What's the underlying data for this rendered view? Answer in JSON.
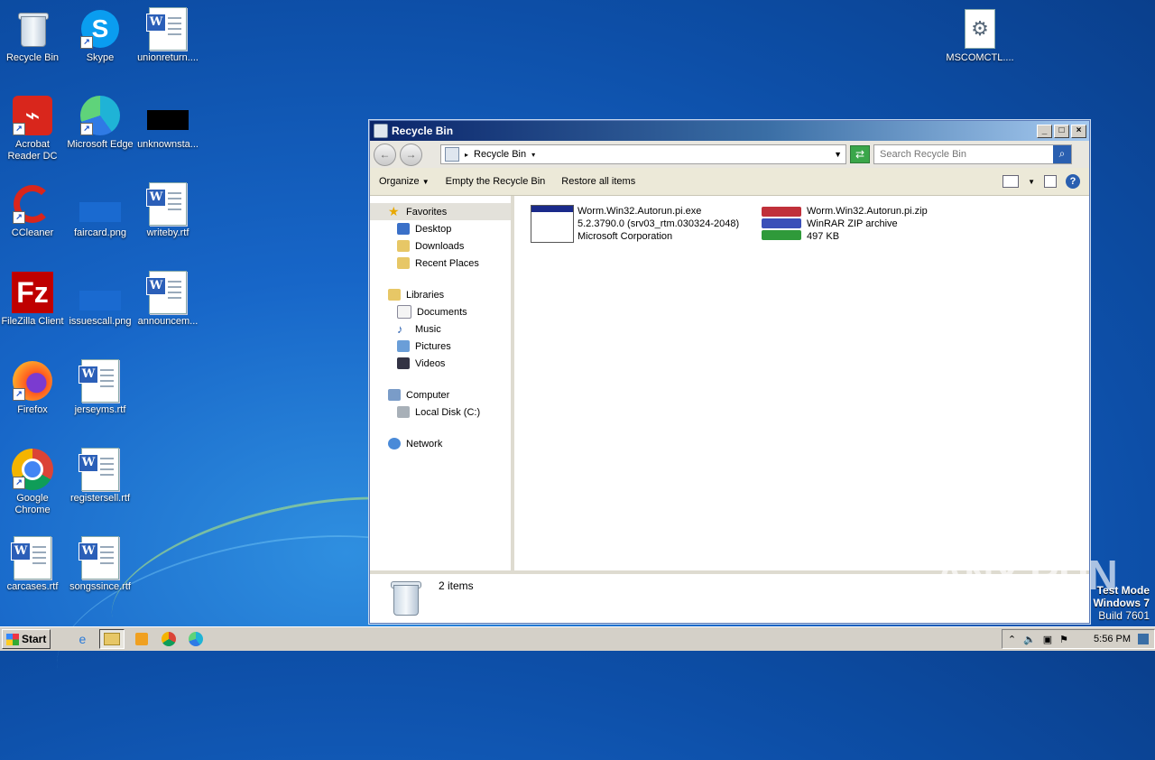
{
  "desktop": {
    "icons": [
      {
        "label": "Recycle Bin"
      },
      {
        "label": "Skype"
      },
      {
        "label": "unionreturn...."
      },
      {
        "label": "Acrobat Reader DC"
      },
      {
        "label": "Microsoft Edge"
      },
      {
        "label": "unknownsta..."
      },
      {
        "label": "CCleaner"
      },
      {
        "label": "faircard.png"
      },
      {
        "label": "writeby.rtf"
      },
      {
        "label": "FileZilla Client"
      },
      {
        "label": "issuescall.png"
      },
      {
        "label": "announcem..."
      },
      {
        "label": "Firefox"
      },
      {
        "label": "jerseyms.rtf"
      },
      {
        "label": "Google Chrome"
      },
      {
        "label": "registersell.rtf"
      },
      {
        "label": "carcases.rtf"
      },
      {
        "label": "songssince.rtf"
      },
      {
        "label": "MSCOMCTL...."
      }
    ],
    "watermark": "ANY RUN",
    "test_mode": {
      "line1": "Test Mode",
      "line2": "Windows 7",
      "line3": "Build 7601"
    }
  },
  "window": {
    "title": "Recycle Bin",
    "address": {
      "location": "Recycle Bin"
    },
    "search": {
      "placeholder": "Search Recycle Bin"
    },
    "commands": {
      "organize": "Organize",
      "empty": "Empty the Recycle Bin",
      "restore": "Restore all items"
    },
    "nav": {
      "favorites": {
        "label": "Favorites",
        "items": [
          "Desktop",
          "Downloads",
          "Recent Places"
        ]
      },
      "libraries": {
        "label": "Libraries",
        "items": [
          "Documents",
          "Music",
          "Pictures",
          "Videos"
        ]
      },
      "computer": {
        "label": "Computer",
        "items": [
          "Local Disk (C:)"
        ]
      },
      "network": {
        "label": "Network"
      }
    },
    "files": [
      {
        "name": "Worm.Win32.Autorun.pi.exe",
        "line2": "5.2.3790.0 (srv03_rtm.030324-2048)",
        "line3": "Microsoft Corporation"
      },
      {
        "name": "Worm.Win32.Autorun.pi.zip",
        "line2": "WinRAR ZIP archive",
        "line3": "497 KB"
      }
    ],
    "status": {
      "count": "2 items"
    }
  },
  "taskbar": {
    "start": "Start",
    "clock": "5:56 PM"
  }
}
